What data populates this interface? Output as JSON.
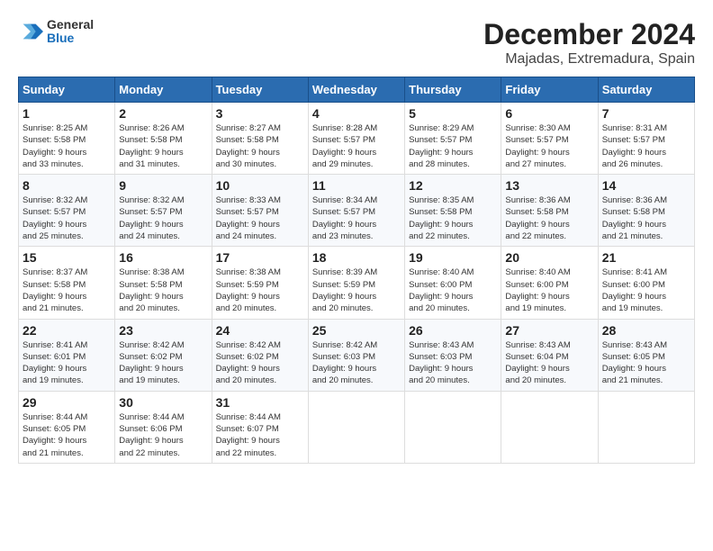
{
  "logo": {
    "line1": "General",
    "line2": "Blue"
  },
  "title": "December 2024",
  "subtitle": "Majadas, Extremadura, Spain",
  "days_of_week": [
    "Sunday",
    "Monday",
    "Tuesday",
    "Wednesday",
    "Thursday",
    "Friday",
    "Saturday"
  ],
  "weeks": [
    [
      {
        "day": "1",
        "info": "Sunrise: 8:25 AM\nSunset: 5:58 PM\nDaylight: 9 hours\nand 33 minutes."
      },
      {
        "day": "2",
        "info": "Sunrise: 8:26 AM\nSunset: 5:58 PM\nDaylight: 9 hours\nand 31 minutes."
      },
      {
        "day": "3",
        "info": "Sunrise: 8:27 AM\nSunset: 5:58 PM\nDaylight: 9 hours\nand 30 minutes."
      },
      {
        "day": "4",
        "info": "Sunrise: 8:28 AM\nSunset: 5:57 PM\nDaylight: 9 hours\nand 29 minutes."
      },
      {
        "day": "5",
        "info": "Sunrise: 8:29 AM\nSunset: 5:57 PM\nDaylight: 9 hours\nand 28 minutes."
      },
      {
        "day": "6",
        "info": "Sunrise: 8:30 AM\nSunset: 5:57 PM\nDaylight: 9 hours\nand 27 minutes."
      },
      {
        "day": "7",
        "info": "Sunrise: 8:31 AM\nSunset: 5:57 PM\nDaylight: 9 hours\nand 26 minutes."
      }
    ],
    [
      {
        "day": "8",
        "info": "Sunrise: 8:32 AM\nSunset: 5:57 PM\nDaylight: 9 hours\nand 25 minutes."
      },
      {
        "day": "9",
        "info": "Sunrise: 8:32 AM\nSunset: 5:57 PM\nDaylight: 9 hours\nand 24 minutes."
      },
      {
        "day": "10",
        "info": "Sunrise: 8:33 AM\nSunset: 5:57 PM\nDaylight: 9 hours\nand 24 minutes."
      },
      {
        "day": "11",
        "info": "Sunrise: 8:34 AM\nSunset: 5:57 PM\nDaylight: 9 hours\nand 23 minutes."
      },
      {
        "day": "12",
        "info": "Sunrise: 8:35 AM\nSunset: 5:58 PM\nDaylight: 9 hours\nand 22 minutes."
      },
      {
        "day": "13",
        "info": "Sunrise: 8:36 AM\nSunset: 5:58 PM\nDaylight: 9 hours\nand 22 minutes."
      },
      {
        "day": "14",
        "info": "Sunrise: 8:36 AM\nSunset: 5:58 PM\nDaylight: 9 hours\nand 21 minutes."
      }
    ],
    [
      {
        "day": "15",
        "info": "Sunrise: 8:37 AM\nSunset: 5:58 PM\nDaylight: 9 hours\nand 21 minutes."
      },
      {
        "day": "16",
        "info": "Sunrise: 8:38 AM\nSunset: 5:58 PM\nDaylight: 9 hours\nand 20 minutes."
      },
      {
        "day": "17",
        "info": "Sunrise: 8:38 AM\nSunset: 5:59 PM\nDaylight: 9 hours\nand 20 minutes."
      },
      {
        "day": "18",
        "info": "Sunrise: 8:39 AM\nSunset: 5:59 PM\nDaylight: 9 hours\nand 20 minutes."
      },
      {
        "day": "19",
        "info": "Sunrise: 8:40 AM\nSunset: 6:00 PM\nDaylight: 9 hours\nand 20 minutes."
      },
      {
        "day": "20",
        "info": "Sunrise: 8:40 AM\nSunset: 6:00 PM\nDaylight: 9 hours\nand 19 minutes."
      },
      {
        "day": "21",
        "info": "Sunrise: 8:41 AM\nSunset: 6:00 PM\nDaylight: 9 hours\nand 19 minutes."
      }
    ],
    [
      {
        "day": "22",
        "info": "Sunrise: 8:41 AM\nSunset: 6:01 PM\nDaylight: 9 hours\nand 19 minutes."
      },
      {
        "day": "23",
        "info": "Sunrise: 8:42 AM\nSunset: 6:02 PM\nDaylight: 9 hours\nand 19 minutes."
      },
      {
        "day": "24",
        "info": "Sunrise: 8:42 AM\nSunset: 6:02 PM\nDaylight: 9 hours\nand 20 minutes."
      },
      {
        "day": "25",
        "info": "Sunrise: 8:42 AM\nSunset: 6:03 PM\nDaylight: 9 hours\nand 20 minutes."
      },
      {
        "day": "26",
        "info": "Sunrise: 8:43 AM\nSunset: 6:03 PM\nDaylight: 9 hours\nand 20 minutes."
      },
      {
        "day": "27",
        "info": "Sunrise: 8:43 AM\nSunset: 6:04 PM\nDaylight: 9 hours\nand 20 minutes."
      },
      {
        "day": "28",
        "info": "Sunrise: 8:43 AM\nSunset: 6:05 PM\nDaylight: 9 hours\nand 21 minutes."
      }
    ],
    [
      {
        "day": "29",
        "info": "Sunrise: 8:44 AM\nSunset: 6:05 PM\nDaylight: 9 hours\nand 21 minutes."
      },
      {
        "day": "30",
        "info": "Sunrise: 8:44 AM\nSunset: 6:06 PM\nDaylight: 9 hours\nand 22 minutes."
      },
      {
        "day": "31",
        "info": "Sunrise: 8:44 AM\nSunset: 6:07 PM\nDaylight: 9 hours\nand 22 minutes."
      },
      null,
      null,
      null,
      null
    ]
  ]
}
